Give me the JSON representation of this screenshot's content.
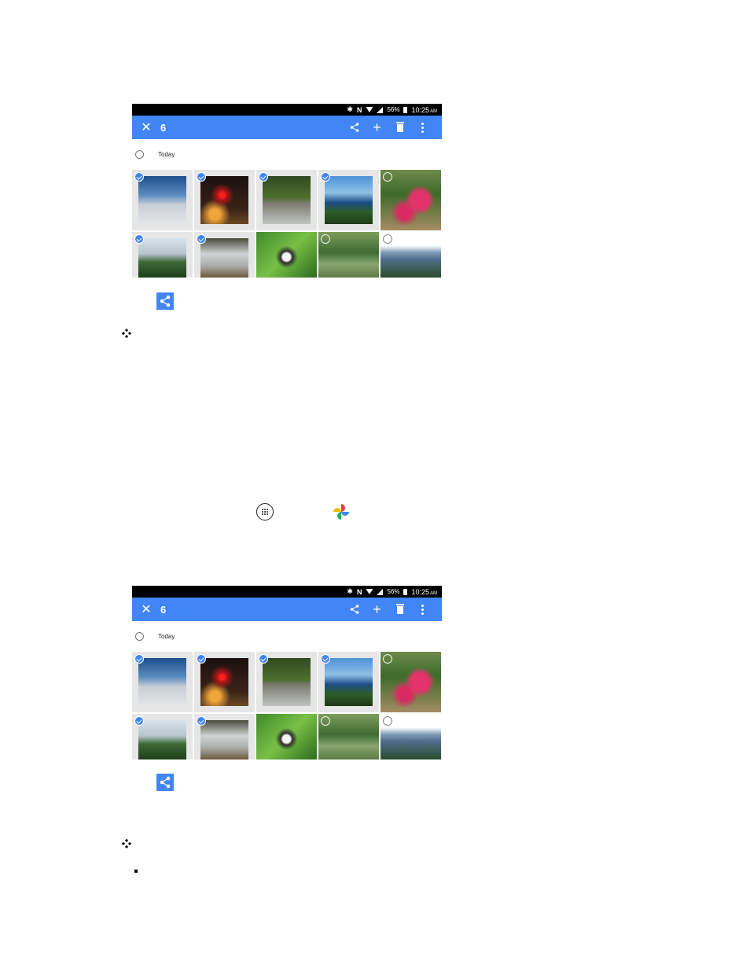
{
  "screenshots": [
    {
      "status": {
        "battery": "56%",
        "time": "10:25",
        "ampm": "AM"
      },
      "appbar": {
        "count": "6"
      },
      "section_label": "Today",
      "photos": [
        {
          "name": "photo-airplane-wing",
          "selected": true
        },
        {
          "name": "photo-night-lights",
          "selected": true
        },
        {
          "name": "photo-glass-forest",
          "selected": true
        },
        {
          "name": "photo-sea-cliff",
          "selected": true
        },
        {
          "name": "photo-flower-garden",
          "selected": false
        },
        {
          "name": "photo-hillside",
          "selected": true
        },
        {
          "name": "photo-glass-table",
          "selected": true
        },
        {
          "name": "photo-butterfly",
          "selected": false
        },
        {
          "name": "photo-garden-path",
          "selected": false
        },
        {
          "name": "photo-valley",
          "selected": false
        }
      ]
    },
    {
      "status": {
        "battery": "56%",
        "time": "10:25",
        "ampm": "AM"
      },
      "appbar": {
        "count": "6"
      },
      "section_label": "Today",
      "photos": [
        {
          "name": "photo-airplane-wing",
          "selected": true
        },
        {
          "name": "photo-night-lights",
          "selected": true
        },
        {
          "name": "photo-glass-forest",
          "selected": true
        },
        {
          "name": "photo-sea-cliff",
          "selected": true
        },
        {
          "name": "photo-flower-garden",
          "selected": false
        },
        {
          "name": "photo-hillside",
          "selected": true
        },
        {
          "name": "photo-glass-table",
          "selected": true
        },
        {
          "name": "photo-butterfly",
          "selected": false
        },
        {
          "name": "photo-garden-path",
          "selected": false
        },
        {
          "name": "photo-valley",
          "selected": false
        }
      ]
    }
  ],
  "icons": {
    "share": "share-icon",
    "apps": "apps-icon",
    "photos": "google-photos-icon",
    "bullet": "diamond-bullet-icon"
  },
  "colors": {
    "accent": "#4285f4",
    "statusbar": "#000000"
  }
}
